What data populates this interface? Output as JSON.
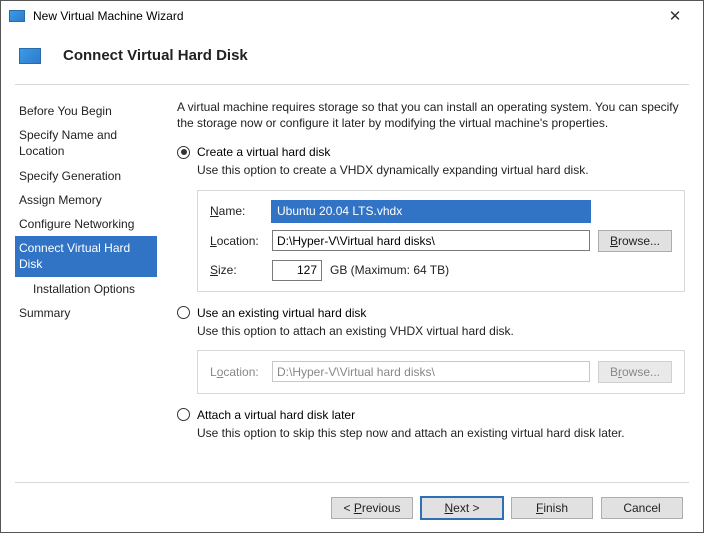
{
  "window": {
    "title": "New Virtual Machine Wizard"
  },
  "header": {
    "title": "Connect Virtual Hard Disk"
  },
  "sidebar": {
    "items": [
      {
        "label": "Before You Begin"
      },
      {
        "label": "Specify Name and Location"
      },
      {
        "label": "Specify Generation"
      },
      {
        "label": "Assign Memory"
      },
      {
        "label": "Configure Networking"
      },
      {
        "label": "Connect Virtual Hard Disk"
      },
      {
        "label": "Installation Options"
      },
      {
        "label": "Summary"
      }
    ]
  },
  "main": {
    "intro": "A virtual machine requires storage so that you can install an operating system. You can specify the storage now or configure it later by modifying the virtual machine's properties.",
    "opt_create": {
      "label": "Create a virtual hard disk",
      "hint": "Use this option to create a VHDX dynamically expanding virtual hard disk.",
      "name_label": "Name:",
      "name_value": "Ubuntu 20.04 LTS.vhdx",
      "loc_label": "Location:",
      "loc_value": "D:\\Hyper-V\\Virtual hard disks\\",
      "browse": "Browse...",
      "size_label": "Size:",
      "size_value": "127",
      "size_unit": "GB (Maximum: 64 TB)"
    },
    "opt_existing": {
      "label": "Use an existing virtual hard disk",
      "hint": "Use this option to attach an existing VHDX virtual hard disk.",
      "loc_label": "Location:",
      "loc_value": "D:\\Hyper-V\\Virtual hard disks\\",
      "browse": "Browse..."
    },
    "opt_later": {
      "label": "Attach a virtual hard disk later",
      "hint": "Use this option to skip this step now and attach an existing virtual hard disk later."
    }
  },
  "footer": {
    "previous": "< Previous",
    "next": "Next >",
    "finish": "Finish",
    "cancel": "Cancel"
  }
}
